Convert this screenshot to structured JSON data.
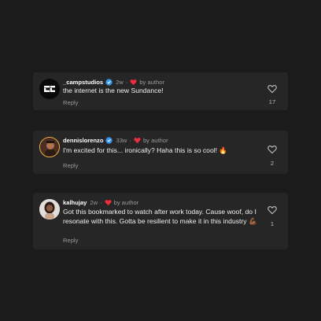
{
  "comments": [
    {
      "username": "_campstudios",
      "time": "2w",
      "author_tag": "by author",
      "text": "the internet is the new Sundance!",
      "reply_label": "Reply",
      "like_count": "17",
      "verified": true
    },
    {
      "username": "dennislorenzo",
      "time": "33w",
      "author_tag": "by author",
      "text": "I'm excited for this... ironically? Haha this is so cool! 🔥",
      "reply_label": "Reply",
      "like_count": "2",
      "verified": true
    },
    {
      "username": "kalhujay",
      "time": "2w",
      "author_tag": "by author",
      "text": "Got this bookmarked to watch after work today. Cause woof, do I resonate with this. Gotta be resilient to make it in this industry 💪🏾",
      "reply_label": "Reply",
      "like_count": "1",
      "verified": false
    }
  ],
  "colors": {
    "background": "#1b1b1b",
    "card": "#262626",
    "verified_blue": "#3897f0",
    "heart_red": "#ed2d3b",
    "muted_text": "#9a9a9a"
  },
  "icons": [
    "verified-badge-icon",
    "heart-filled-icon",
    "heart-outline-icon"
  ]
}
